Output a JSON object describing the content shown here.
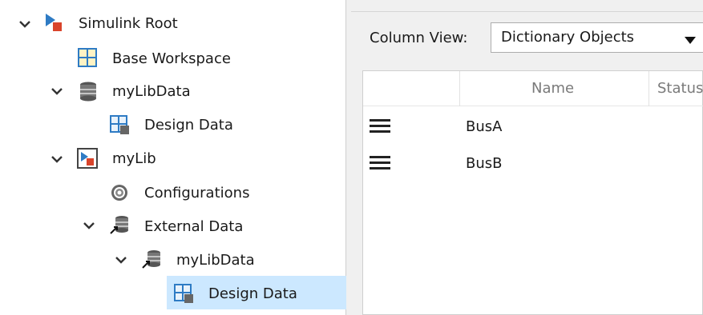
{
  "tree": {
    "items": [
      {
        "label": "Simulink Root",
        "icon": "simulink-model-icon",
        "expanded": true
      },
      {
        "label": "Base Workspace",
        "icon": "workspace-grid-icon"
      },
      {
        "label": "myLibData",
        "icon": "database-icon",
        "expanded": true
      },
      {
        "label": "Design Data",
        "icon": "design-data-icon"
      },
      {
        "label": "myLib",
        "icon": "library-model-icon",
        "expanded": true
      },
      {
        "label": "Configurations",
        "icon": "gear-icon"
      },
      {
        "label": "External Data",
        "icon": "linked-database-icon",
        "expanded": true
      },
      {
        "label": "myLibData",
        "icon": "linked-database-icon",
        "expanded": true
      },
      {
        "label": "Design Data",
        "icon": "design-data-icon",
        "selected": true
      }
    ]
  },
  "column_view": {
    "label": "Column View:",
    "selected": "Dictionary Objects"
  },
  "grid": {
    "headers": [
      "Name",
      "Status"
    ],
    "rows": [
      {
        "name": "BusA"
      },
      {
        "name": "BusB"
      }
    ]
  },
  "colors": {
    "selection": "#cce8ff",
    "icon_blue": "#2e7bc4",
    "icon_orange": "#e8a000",
    "icon_red": "#c0392b"
  }
}
